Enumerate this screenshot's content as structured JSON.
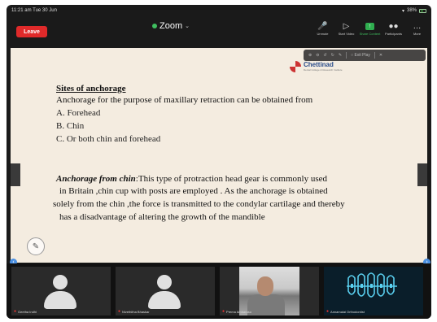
{
  "status_bar": {
    "time": "11:21 am",
    "date": "Tue 30 Jun",
    "battery": "38%"
  },
  "header": {
    "leave_label": "Leave",
    "app_title": "Zoom",
    "toolbar": [
      {
        "label": "Unmute",
        "icon": "mic-muted-icon"
      },
      {
        "label": "Start Video",
        "icon": "video-off-icon"
      },
      {
        "label": "Share Content",
        "icon": "share-icon"
      },
      {
        "label": "Participants",
        "icon": "participants-icon"
      },
      {
        "label": "More",
        "icon": "more-icon"
      }
    ]
  },
  "annotation_toolbar": {
    "exit_label": "Exit Play"
  },
  "slide": {
    "logo_text": "Chettinad",
    "logo_subtext": "Dental College & Research Institute",
    "heading": "Sites of anchorage",
    "intro": "Anchorage for the purpose of maxillary retraction can be obtained from",
    "options": [
      "A. Forehead",
      "B. Chin",
      "C. Or both chin and forehead"
    ],
    "para_emph": "Anchorage from chin",
    "para_lines": [
      ":This type of protraction head gear is commonly used",
      "in Britain ,chin cup with posts are employed . As the anchorage is obtained",
      "solely from the chin ,the force is transmitted to the condylar cartilage and thereby",
      "has a disadvantage of altering the growth of the mandible"
    ]
  },
  "participants": [
    {
      "name": "Geetha Indhi"
    },
    {
      "name": "Nivethitha Bhaskar"
    },
    {
      "name": "Prema Ambarasu"
    },
    {
      "name": "Annamalai Orthodontist"
    }
  ],
  "colors": {
    "leave": "#e02a2a",
    "zoom_green": "#3fbf5f",
    "slide_bg": "#f4ece0",
    "strip_bg": "#111111"
  }
}
